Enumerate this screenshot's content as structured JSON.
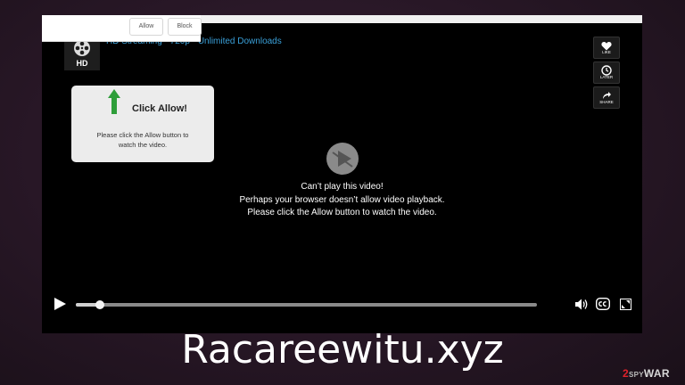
{
  "notification_prompt": {
    "allow_label": "Allow",
    "block_label": "Block"
  },
  "player": {
    "logo_text": "HD",
    "site_title": "HD Streaming - 720p - Unlimited Downloads",
    "side_actions": [
      {
        "icon": "heart-icon",
        "label": "LIKE"
      },
      {
        "icon": "clock-icon",
        "label": "LATER"
      },
      {
        "icon": "share-icon",
        "label": "SHARE"
      }
    ],
    "notice": {
      "title": "Click Allow!",
      "body": "Please click the Allow button to watch the video."
    },
    "message": {
      "line1": "Can’t play this video!",
      "line2": "Perhaps your browser doesn’t allow video playback.",
      "line3": "Please click the Allow button to watch the video."
    },
    "progress_fraction": 0.03
  },
  "caption": "Racareewitu.xyz",
  "watermark": {
    "prefix": "2",
    "middle": "SPY",
    "suffix": "WAR"
  },
  "colors": {
    "background": "#2a1828",
    "link_blue": "#3aa0d9",
    "arrow_green": "#2e9e3a",
    "watermark_red": "#e0222b"
  }
}
